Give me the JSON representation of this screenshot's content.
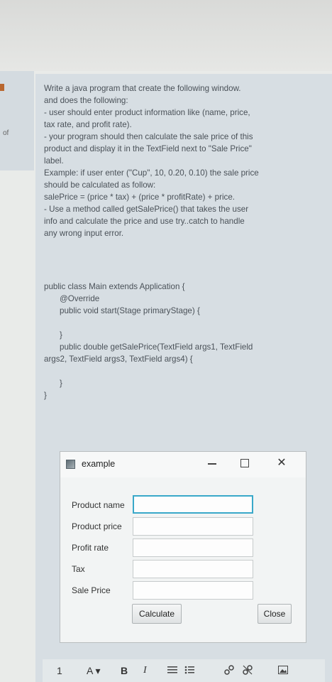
{
  "question": {
    "lines": [
      "Write a java program that create the following window.",
      "and does the following:",
      "- user should enter product information like (name, price,",
      "tax rate, and profit rate).",
      "- your program should then calculate the sale price of this",
      "product and display it in the TextField next to \"Sale Price\"",
      "label.",
      "Example: if user enter (\"Cup\", 10, 0.20, 0.10) the sale price",
      "should be calculated as follow:",
      "salePrice = (price * tax) + (price * profitRate) + price.",
      "- Use a method called getSalePrice() that takes the user",
      "info and calculate the price and use try..catch to handle",
      "any wrong input error."
    ]
  },
  "code": {
    "class_decl": "public class Main extends Application {",
    "override": "@Override",
    "start_sig": "public void start(Stage primaryStage) {",
    "close_brace_1": "}",
    "method_sig_1": "public double getSalePrice(TextField args1, TextField",
    "method_sig_2": "args2, TextField args3, TextField args4) {",
    "close_brace_2": "}",
    "close_brace_3": "}"
  },
  "sidebar": {
    "mark": "of"
  },
  "window": {
    "title": "example",
    "close_glyph": "✕",
    "labels": {
      "product_name": "Product name",
      "product_price": "Product price",
      "profit_rate": "Profit rate",
      "tax": "Tax",
      "sale_price": "Sale Price"
    },
    "fields": {
      "product_name": "",
      "product_price": "",
      "profit_rate": "",
      "tax": "",
      "sale_price": ""
    },
    "buttons": {
      "calculate": "Calculate",
      "close": "Close"
    }
  },
  "toolbar": {
    "first_glyph": "1",
    "font_color": "A ▾",
    "bold": "B",
    "italic": "I"
  },
  "colors": {
    "focus_border": "#39a8c9",
    "card_bg": "#d7dee3"
  }
}
